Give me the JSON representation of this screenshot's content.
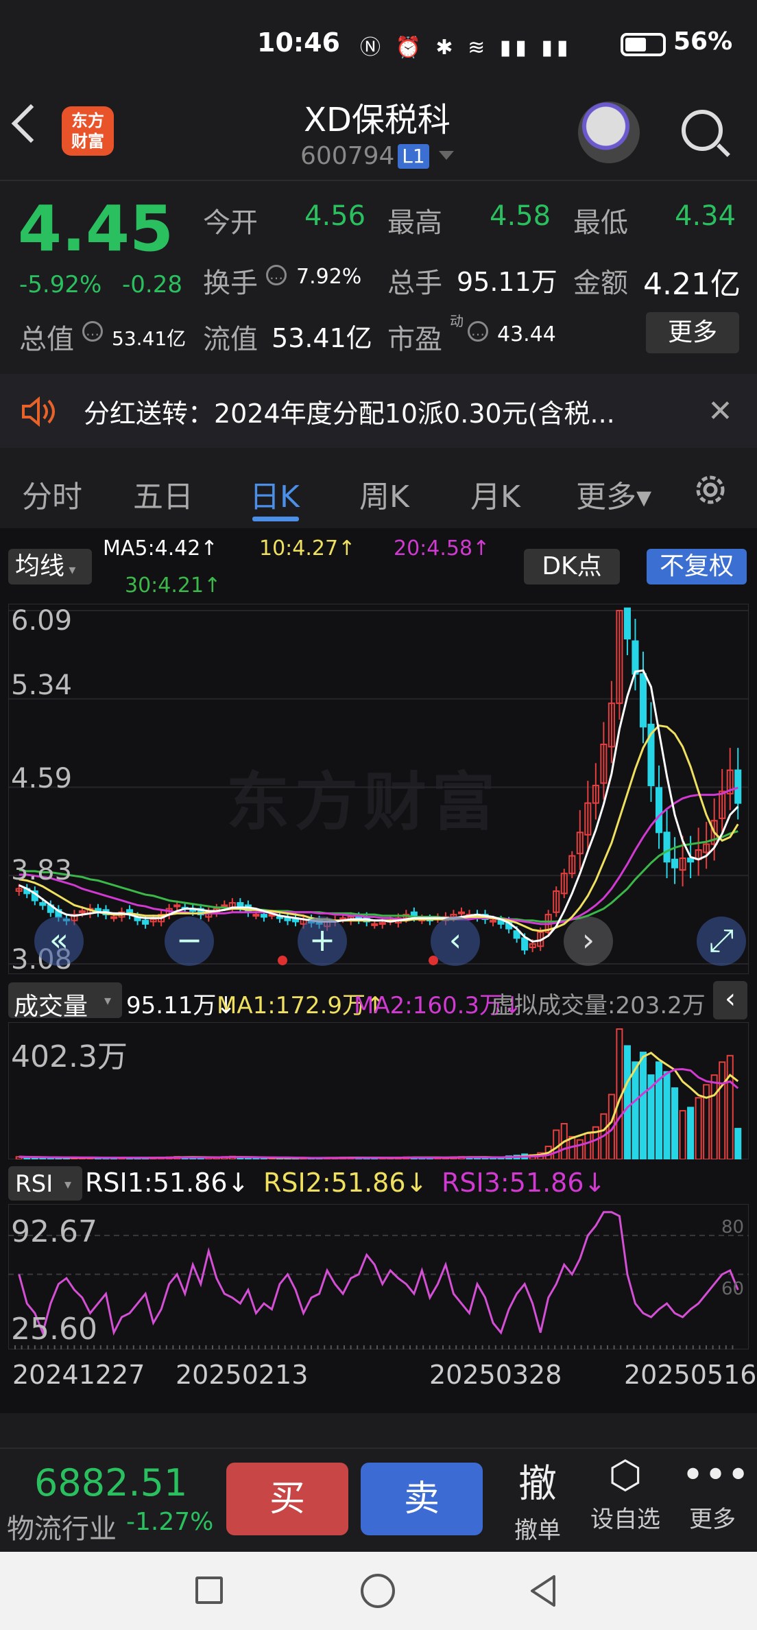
{
  "status_bar": {
    "time": "10:46",
    "battery_pct": "56%",
    "battery_level": 0.56
  },
  "header": {
    "stock_name": "XD保税科",
    "stock_code": "600794",
    "level_badge": "L1",
    "logo_text_line1": "东方",
    "logo_text_line2": "财富"
  },
  "quote": {
    "price": "4.45",
    "change_pct": "-5.92%",
    "change_abs": "-0.28",
    "open_label": "今开",
    "open_value": "4.56",
    "high_label": "最高",
    "high_value": "4.58",
    "low_label": "最低",
    "low_value": "4.34",
    "turnover_label": "换手",
    "turnover_value": "7.92%",
    "volume_label": "总手",
    "volume_value": "95.11万",
    "amount_label": "金额",
    "amount_value": "4.21亿",
    "mktcap_label": "总值",
    "mktcap_value": "53.41亿",
    "float_label": "流值",
    "float_value": "53.41亿",
    "pe_label": "市盈",
    "pe_sup": "动",
    "pe_value": "43.44",
    "more_label": "更多"
  },
  "notice": {
    "text": "分红送转：2024年度分配10派0.30元(含税..."
  },
  "tabs": [
    {
      "label": "分时"
    },
    {
      "label": "五日"
    },
    {
      "label": "日K"
    },
    {
      "label": "周K"
    },
    {
      "label": "月K"
    },
    {
      "label": "更多▾"
    }
  ],
  "chart_controls": {
    "ma_button": "均线",
    "dk_button": "DK点",
    "adjust_button": "不复权",
    "ma5": "MA5:4.42↑",
    "ma10": "10:4.27↑",
    "ma20": "20:4.58↑",
    "ma30": "30:4.21↑",
    "watermark": "东方财富"
  },
  "volume_panel": {
    "label": "成交量",
    "vol": "95.11万↓",
    "ma1": "MA1:172.9万↑",
    "ma2": "MA2:160.3万↓",
    "virtual": "虚拟成交量:203.2万",
    "max_label": "402.3万"
  },
  "rsi_panel": {
    "label": "RSI",
    "rsi1": "RSI1:51.86↓",
    "rsi2": "RSI2:51.86↓",
    "rsi3": "RSI3:51.86↓",
    "max_label": "92.67",
    "min_label": "25.60",
    "ref_80": "80",
    "ref_60": "60"
  },
  "chart_data": {
    "type": "candlestick",
    "y_ticks": [
      "6.09",
      "5.34",
      "4.59",
      "3.83",
      "3.08"
    ],
    "ylim": [
      3.08,
      6.09
    ],
    "x_tick_labels": [
      "20241227",
      "20250213",
      "20250328",
      "20250516"
    ],
    "closes": [
      3.72,
      3.68,
      3.62,
      3.58,
      3.52,
      3.48,
      3.45,
      3.5,
      3.53,
      3.55,
      3.52,
      3.5,
      3.48,
      3.52,
      3.5,
      3.45,
      3.42,
      3.46,
      3.5,
      3.55,
      3.58,
      3.55,
      3.53,
      3.5,
      3.52,
      3.55,
      3.58,
      3.6,
      3.56,
      3.52,
      3.5,
      3.48,
      3.5,
      3.47,
      3.45,
      3.44,
      3.46,
      3.43,
      3.42,
      3.44,
      3.45,
      3.47,
      3.48,
      3.46,
      3.44,
      3.42,
      3.43,
      3.45,
      3.47,
      3.5,
      3.48,
      3.46,
      3.45,
      3.47,
      3.48,
      3.5,
      3.52,
      3.5,
      3.48,
      3.46,
      3.45,
      3.42,
      3.38,
      3.3,
      3.2,
      3.25,
      3.35,
      3.5,
      3.7,
      3.85,
      4.0,
      4.2,
      4.45,
      4.6,
      4.95,
      5.3,
      6.09,
      5.85,
      5.55,
      5.1,
      4.6,
      4.2,
      3.95,
      3.9,
      3.98,
      3.95,
      4.05,
      4.1,
      4.3,
      4.55,
      4.73,
      4.45
    ],
    "ma5": [
      3.75,
      3.72,
      3.68,
      3.63,
      3.58,
      3.53,
      3.5,
      3.49,
      3.5,
      3.51,
      3.52,
      3.52,
      3.51,
      3.51,
      3.5,
      3.48,
      3.47,
      3.47,
      3.47,
      3.5,
      3.53,
      3.55,
      3.55,
      3.54,
      3.53,
      3.53,
      3.54,
      3.56,
      3.56,
      3.56,
      3.55,
      3.53,
      3.51,
      3.49,
      3.48,
      3.47,
      3.46,
      3.45,
      3.44,
      3.44,
      3.44,
      3.45,
      3.46,
      3.46,
      3.46,
      3.45,
      3.45,
      3.44,
      3.45,
      3.46,
      3.47,
      3.47,
      3.47,
      3.47,
      3.47,
      3.47,
      3.48,
      3.49,
      3.5,
      3.49,
      3.48,
      3.46,
      3.43,
      3.38,
      3.31,
      3.27,
      3.28,
      3.32,
      3.4,
      3.53,
      3.68,
      3.85,
      4.04,
      4.22,
      4.44,
      4.7,
      5.08,
      5.36,
      5.57,
      5.58,
      5.44,
      5.06,
      4.68,
      4.35,
      4.13,
      3.99,
      3.97,
      4.0,
      4.07,
      4.19,
      4.35,
      4.42
    ],
    "ma10": [
      3.8,
      3.79,
      3.77,
      3.74,
      3.7,
      3.66,
      3.62,
      3.58,
      3.56,
      3.54,
      3.52,
      3.51,
      3.5,
      3.5,
      3.51,
      3.5,
      3.49,
      3.49,
      3.49,
      3.5,
      3.51,
      3.51,
      3.51,
      3.51,
      3.52,
      3.53,
      3.54,
      3.55,
      3.55,
      3.54,
      3.54,
      3.53,
      3.53,
      3.52,
      3.51,
      3.5,
      3.49,
      3.47,
      3.46,
      3.46,
      3.45,
      3.45,
      3.45,
      3.45,
      3.45,
      3.45,
      3.45,
      3.45,
      3.45,
      3.45,
      3.46,
      3.46,
      3.46,
      3.46,
      3.46,
      3.46,
      3.47,
      3.48,
      3.48,
      3.48,
      3.47,
      3.46,
      3.45,
      3.43,
      3.4,
      3.37,
      3.36,
      3.37,
      3.39,
      3.42,
      3.48,
      3.56,
      3.66,
      3.79,
      3.95,
      4.11,
      4.32,
      4.53,
      4.74,
      4.92,
      5.04,
      5.11,
      5.1,
      5.04,
      4.93,
      4.76,
      4.55,
      4.35,
      4.2,
      4.13,
      4.16,
      4.27
    ],
    "ma20": [
      3.84,
      3.84,
      3.83,
      3.82,
      3.81,
      3.79,
      3.77,
      3.75,
      3.72,
      3.7,
      3.68,
      3.66,
      3.64,
      3.62,
      3.6,
      3.58,
      3.57,
      3.55,
      3.54,
      3.53,
      3.52,
      3.52,
      3.51,
      3.51,
      3.51,
      3.51,
      3.51,
      3.52,
      3.52,
      3.52,
      3.52,
      3.52,
      3.52,
      3.52,
      3.52,
      3.52,
      3.52,
      3.52,
      3.51,
      3.51,
      3.5,
      3.5,
      3.49,
      3.49,
      3.48,
      3.48,
      3.47,
      3.47,
      3.46,
      3.46,
      3.46,
      3.46,
      3.46,
      3.46,
      3.46,
      3.46,
      3.46,
      3.46,
      3.47,
      3.47,
      3.47,
      3.46,
      3.46,
      3.45,
      3.44,
      3.43,
      3.42,
      3.42,
      3.43,
      3.44,
      3.46,
      3.49,
      3.53,
      3.58,
      3.64,
      3.72,
      3.82,
      3.93,
      4.05,
      4.16,
      4.26,
      4.34,
      4.4,
      4.45,
      4.49,
      4.51,
      4.52,
      4.52,
      4.52,
      4.53,
      4.56,
      4.58
    ],
    "ma30": [
      3.88,
      3.87,
      3.87,
      3.86,
      3.86,
      3.85,
      3.84,
      3.83,
      3.82,
      3.8,
      3.79,
      3.77,
      3.75,
      3.73,
      3.71,
      3.69,
      3.67,
      3.66,
      3.64,
      3.62,
      3.61,
      3.6,
      3.59,
      3.58,
      3.57,
      3.56,
      3.56,
      3.55,
      3.55,
      3.54,
      3.54,
      3.54,
      3.53,
      3.53,
      3.53,
      3.52,
      3.52,
      3.52,
      3.52,
      3.51,
      3.51,
      3.51,
      3.51,
      3.5,
      3.5,
      3.5,
      3.49,
      3.49,
      3.49,
      3.49,
      3.48,
      3.48,
      3.48,
      3.48,
      3.47,
      3.47,
      3.47,
      3.47,
      3.47,
      3.47,
      3.47,
      3.47,
      3.46,
      3.46,
      3.45,
      3.45,
      3.44,
      3.44,
      3.44,
      3.45,
      3.46,
      3.47,
      3.49,
      3.52,
      3.55,
      3.6,
      3.66,
      3.72,
      3.8,
      3.87,
      3.94,
      4.0,
      4.04,
      4.07,
      4.09,
      4.1,
      4.11,
      4.12,
      4.14,
      4.16,
      4.19,
      4.21
    ],
    "volume_ma_note": "volume bars in 万 units",
    "volumes": [
      8,
      7,
      6,
      5,
      6,
      5,
      5,
      6,
      5,
      6,
      5,
      5,
      4,
      5,
      6,
      5,
      4,
      5,
      6,
      7,
      8,
      7,
      6,
      5,
      6,
      7,
      8,
      9,
      6,
      5,
      5,
      4,
      5,
      4,
      4,
      4,
      5,
      4,
      4,
      5,
      5,
      6,
      6,
      5,
      5,
      4,
      5,
      5,
      6,
      7,
      6,
      5,
      5,
      6,
      6,
      7,
      8,
      7,
      6,
      6,
      5,
      7,
      10,
      12,
      16,
      14,
      20,
      40,
      90,
      110,
      70,
      60,
      80,
      100,
      140,
      200,
      402,
      350,
      300,
      330,
      260,
      300,
      270,
      220,
      150,
      160,
      190,
      230,
      260,
      300,
      320,
      95
    ],
    "rsi": [
      60,
      45,
      40,
      30,
      45,
      55,
      58,
      52,
      48,
      40,
      45,
      50,
      30,
      38,
      40,
      45,
      50,
      35,
      42,
      55,
      60,
      50,
      65,
      55,
      72,
      58,
      50,
      48,
      45,
      52,
      40,
      45,
      42,
      55,
      60,
      52,
      40,
      48,
      50,
      62,
      55,
      50,
      58,
      60,
      70,
      65,
      55,
      62,
      58,
      55,
      50,
      62,
      48,
      55,
      65,
      50,
      45,
      40,
      55,
      48,
      35,
      30,
      42,
      50,
      55,
      45,
      30,
      48,
      55,
      65,
      60,
      68,
      80,
      85,
      92,
      92,
      90,
      60,
      45,
      40,
      38,
      42,
      45,
      40,
      38,
      42,
      45,
      50,
      55,
      60,
      62,
      52
    ],
    "rsi_ylim": [
      25.6,
      92.67
    ]
  },
  "action_bar": {
    "index_value": "6882.51",
    "index_name": "物流行业",
    "index_change": "-1.27%",
    "buy_label": "买",
    "sell_label": "卖",
    "cancel_icon": "撤",
    "cancel_label": "撤单",
    "watch_label": "设自选",
    "more_label": "更多"
  },
  "colors": {
    "up": "#e5403f",
    "down": "#27d6e6",
    "green": "#2bc05f",
    "accent": "#4b8fe8",
    "ma5": "#ffffff",
    "ma10": "#f0e060",
    "ma20": "#d03ad0",
    "ma30": "#3cb84a"
  }
}
